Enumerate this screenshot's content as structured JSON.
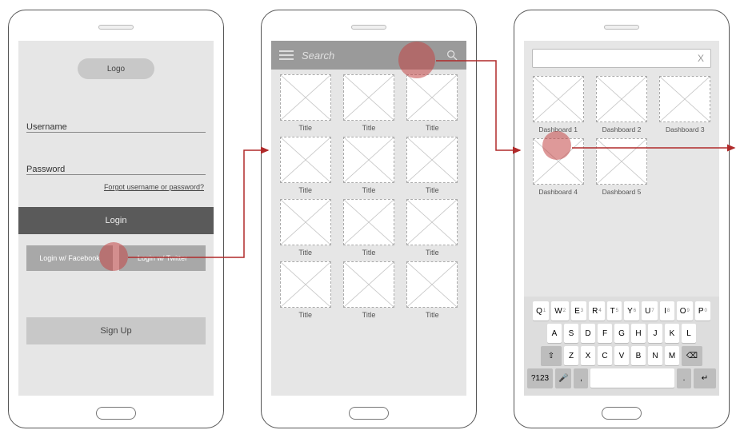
{
  "screen1": {
    "logo": "Logo",
    "username_label": "Username",
    "password_label": "Password",
    "forgot": "Forgot username or password?",
    "login": "Login",
    "fb": "Login w/ Facebook",
    "tw": "Login w/ Twitter",
    "signup": "Sign Up"
  },
  "screen2": {
    "search_placeholder": "Search",
    "tiles": [
      {
        "title": "Title"
      },
      {
        "title": "Title"
      },
      {
        "title": "Title"
      },
      {
        "title": "Title"
      },
      {
        "title": "Title"
      },
      {
        "title": "Title"
      },
      {
        "title": "Title"
      },
      {
        "title": "Title"
      },
      {
        "title": "Title"
      },
      {
        "title": "Title"
      },
      {
        "title": "Title"
      },
      {
        "title": "Title"
      }
    ]
  },
  "screen3": {
    "clear": "X",
    "tiles": [
      {
        "title": "Dashboard 1"
      },
      {
        "title": "Dashboard 2"
      },
      {
        "title": "Dashboard 3"
      },
      {
        "title": "Dashboard 4"
      },
      {
        "title": "Dashboard 5"
      }
    ],
    "keyboard": {
      "row1": [
        "Q",
        "W",
        "E",
        "R",
        "T",
        "Y",
        "U",
        "I",
        "O",
        "P"
      ],
      "row1_sup": [
        "1",
        "2",
        "3",
        "4",
        "5",
        "6",
        "7",
        "8",
        "9",
        "0"
      ],
      "row2": [
        "A",
        "S",
        "D",
        "F",
        "G",
        "H",
        "J",
        "K",
        "L"
      ],
      "row3": [
        "Z",
        "X",
        "C",
        "V",
        "B",
        "N",
        "M"
      ],
      "shift": "⇧",
      "backspace": "⌫",
      "numkey": "?123",
      "comma": ",",
      "period": ".",
      "enter": "↵",
      "mic": "🎤"
    }
  }
}
